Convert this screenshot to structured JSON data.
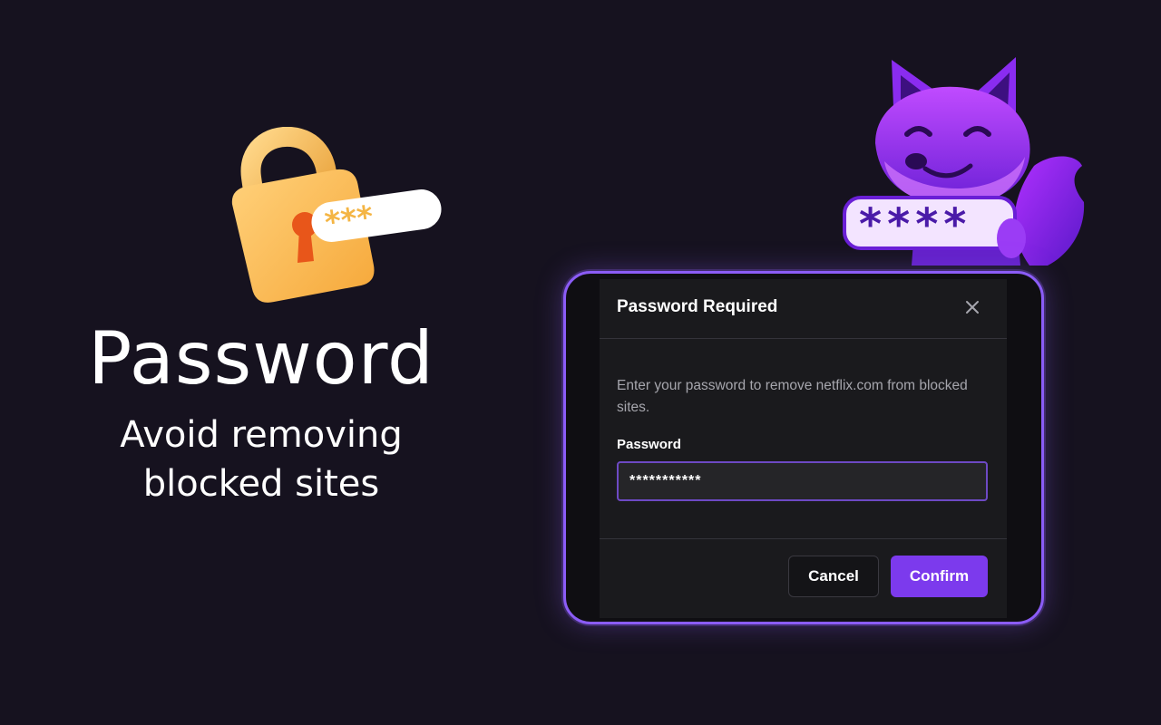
{
  "hero": {
    "title": "Password",
    "subtitle_line1": "Avoid removing",
    "subtitle_line2": "blocked sites"
  },
  "illustrations": {
    "lock_icon": "padlock-icon",
    "lock_stars": "***",
    "fox_icon": "fox-mascot",
    "fox_stars": "****"
  },
  "dialog": {
    "title": "Password Required",
    "close_icon": "close-icon",
    "message": "Enter your password to remove netflix.com from blocked sites.",
    "field_label": "Password",
    "password_value": "***********",
    "cancel_label": "Cancel",
    "confirm_label": "Confirm"
  },
  "colors": {
    "background": "#16121f",
    "accent": "#7c3aed",
    "frame": "#8b5cf6",
    "dialog": "#1a1a1d"
  }
}
